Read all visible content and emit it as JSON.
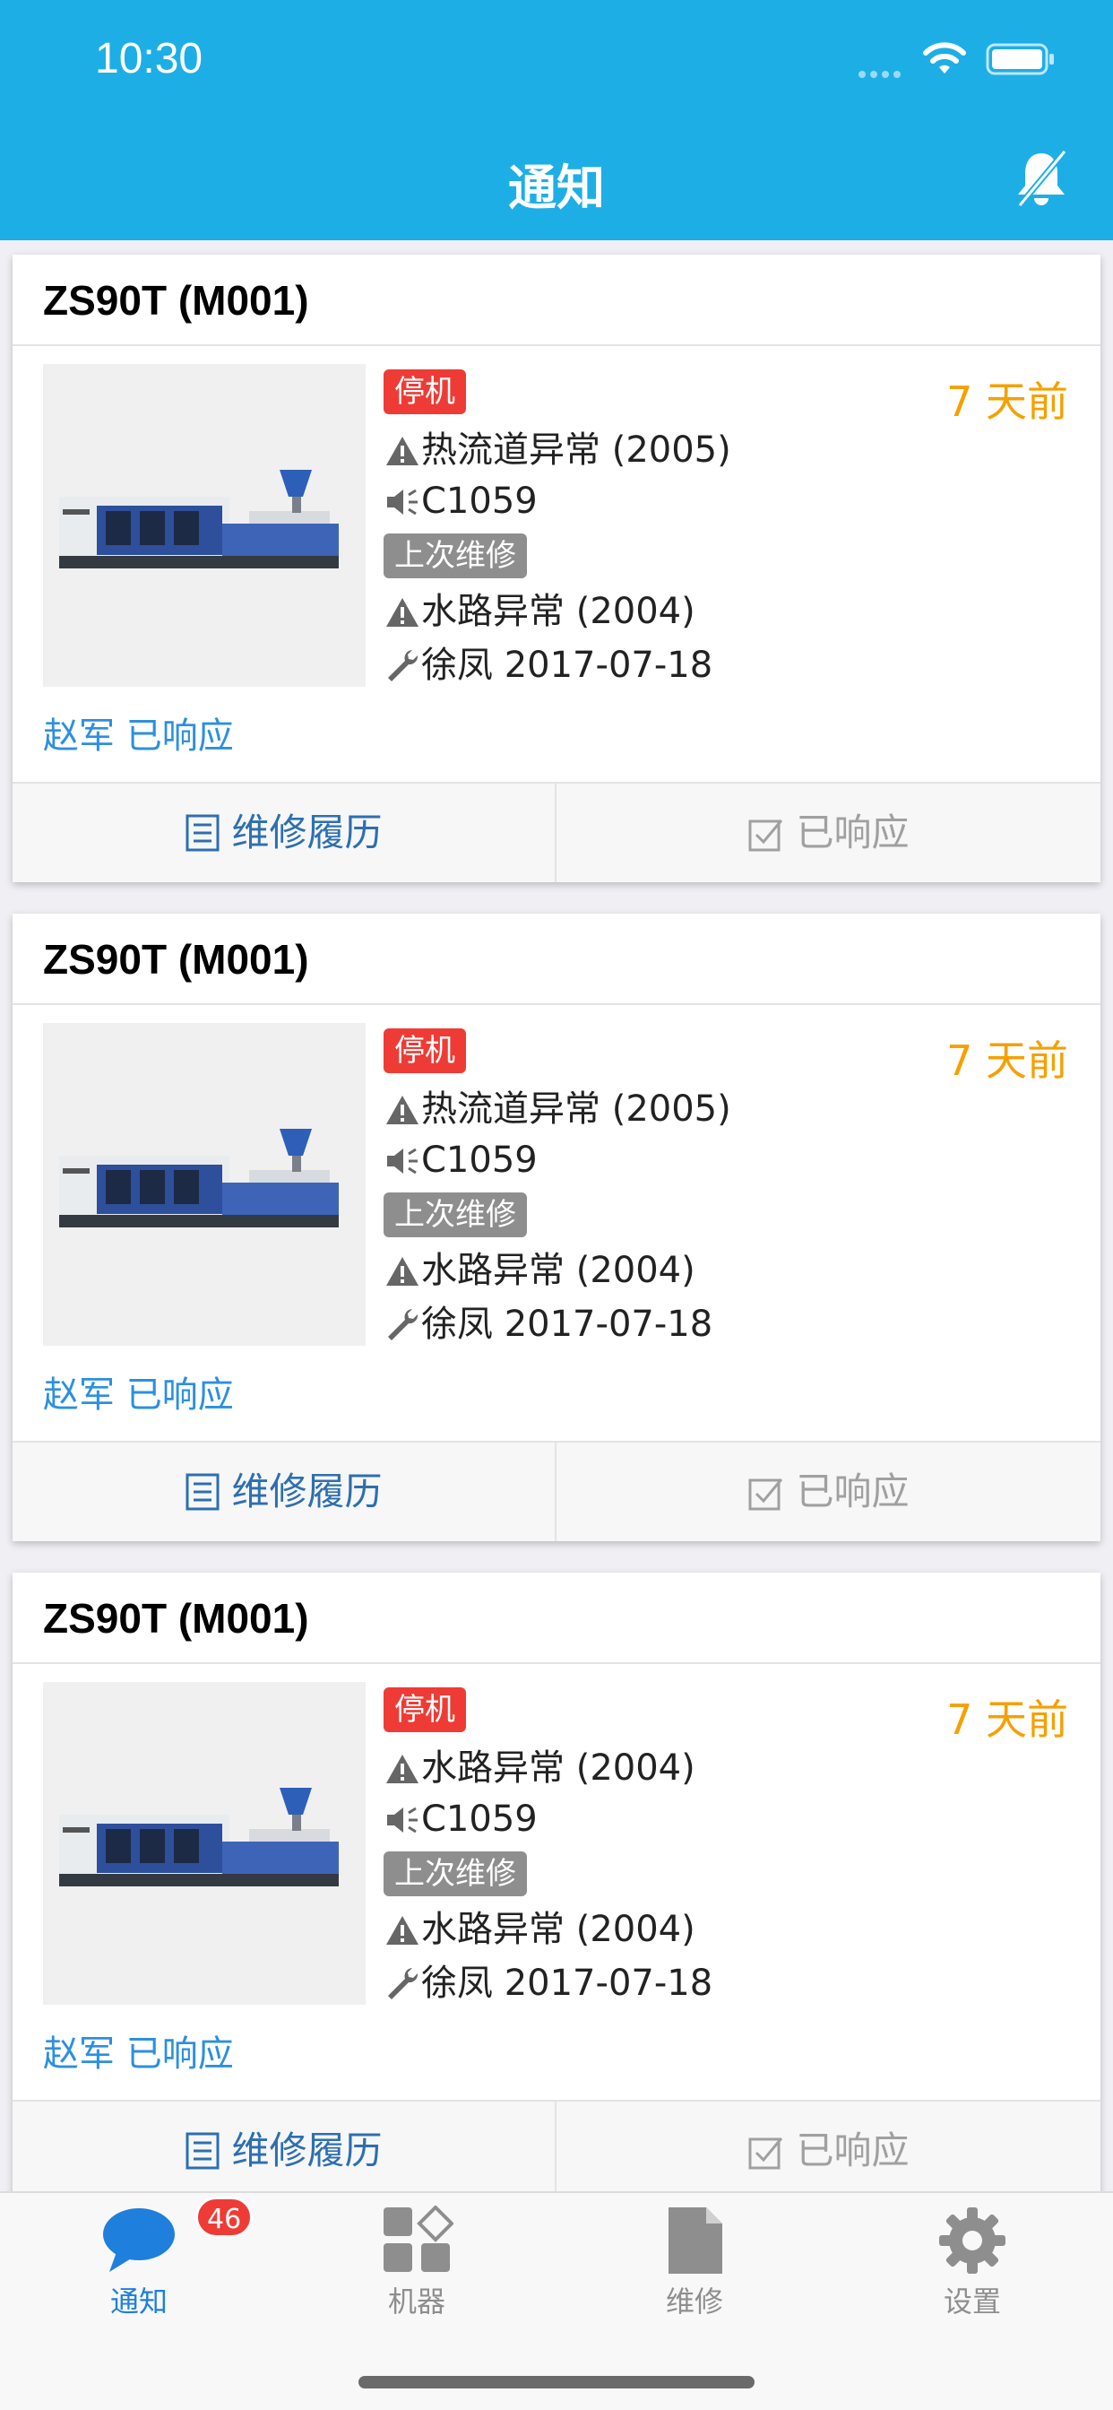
{
  "status_bar": {
    "time": "10:30"
  },
  "header": {
    "title": "通知"
  },
  "cards": [
    {
      "title": "ZS90T (M001)",
      "status_tag": "停机",
      "time_ago": "7 天前",
      "alarm": "热流道异常 (2005)",
      "code": "C1059",
      "last_repair_tag": "上次维修",
      "last_alarm": "水路异常 (2004)",
      "repairer": "徐凤 2017-07-18",
      "responder": "赵军 已响应",
      "history_button": "维修履历",
      "responded_button": "已响应"
    },
    {
      "title": "ZS90T (M001)",
      "status_tag": "停机",
      "time_ago": "7 天前",
      "alarm": "热流道异常 (2005)",
      "code": "C1059",
      "last_repair_tag": "上次维修",
      "last_alarm": "水路异常 (2004)",
      "repairer": "徐凤 2017-07-18",
      "responder": "赵军 已响应",
      "history_button": "维修履历",
      "responded_button": "已响应"
    },
    {
      "title": "ZS90T (M001)",
      "status_tag": "停机",
      "time_ago": "7 天前",
      "alarm": "水路异常 (2004)",
      "code": "C1059",
      "last_repair_tag": "上次维修",
      "last_alarm": "水路异常 (2004)",
      "repairer": "徐凤 2017-07-18",
      "responder": "赵军 已响应",
      "history_button": "维修履历",
      "responded_button": "已响应"
    }
  ],
  "tabbar": {
    "items": [
      {
        "label": "通知",
        "icon": "chat-bubble-icon",
        "badge": "46",
        "active": true
      },
      {
        "label": "机器",
        "icon": "grid-icon",
        "active": false
      },
      {
        "label": "维修",
        "icon": "document-icon",
        "active": false
      },
      {
        "label": "设置",
        "icon": "gear-icon",
        "active": false
      }
    ]
  },
  "colors": {
    "header_bg": "#1eaee6",
    "status_red": "#ef3b35",
    "time_orange": "#f5a000",
    "link_blue": "#2d8fe0",
    "tab_active": "#1e7fdc"
  }
}
